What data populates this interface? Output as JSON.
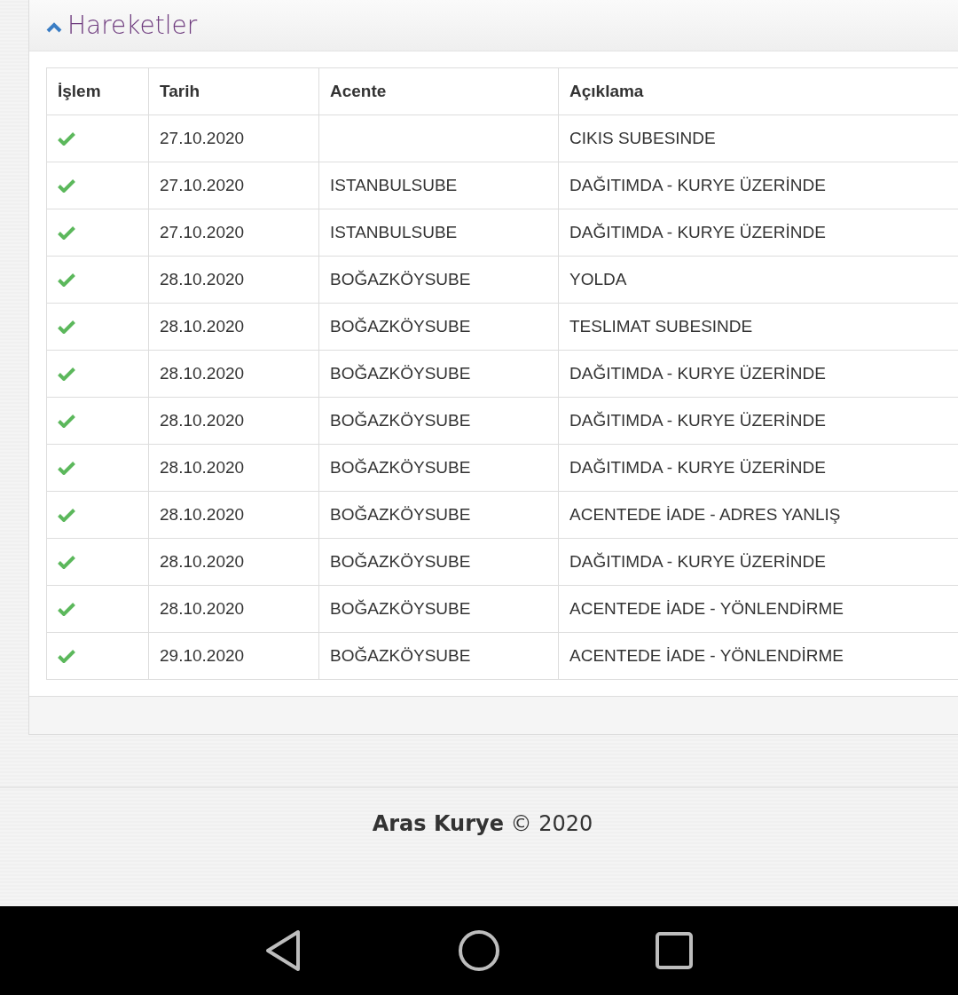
{
  "panel": {
    "title": "Hareketler"
  },
  "table": {
    "columns": [
      "İşlem",
      "Tarih",
      "Acente",
      "Açıklama"
    ],
    "rows": [
      {
        "date": "27.10.2020",
        "agent": "",
        "description": "CIKIS SUBESINDE"
      },
      {
        "date": "27.10.2020",
        "agent": "ISTANBULSUBE",
        "description": "DAĞITIMDA - KURYE ÜZERİNDE"
      },
      {
        "date": "27.10.2020",
        "agent": "ISTANBULSUBE",
        "description": "DAĞITIMDA - KURYE ÜZERİNDE"
      },
      {
        "date": "28.10.2020",
        "agent": "BOĞAZKÖYSUBE",
        "description": "YOLDA"
      },
      {
        "date": "28.10.2020",
        "agent": "BOĞAZKÖYSUBE",
        "description": "TESLIMAT SUBESINDE"
      },
      {
        "date": "28.10.2020",
        "agent": "BOĞAZKÖYSUBE",
        "description": "DAĞITIMDA - KURYE ÜZERİNDE"
      },
      {
        "date": "28.10.2020",
        "agent": "BOĞAZKÖYSUBE",
        "description": "DAĞITIMDA - KURYE ÜZERİNDE"
      },
      {
        "date": "28.10.2020",
        "agent": "BOĞAZKÖYSUBE",
        "description": "DAĞITIMDA - KURYE ÜZERİNDE"
      },
      {
        "date": "28.10.2020",
        "agent": "BOĞAZKÖYSUBE",
        "description": "ACENTEDE İADE - ADRES YANLIŞ"
      },
      {
        "date": "28.10.2020",
        "agent": "BOĞAZKÖYSUBE",
        "description": "DAĞITIMDA - KURYE ÜZERİNDE"
      },
      {
        "date": "28.10.2020",
        "agent": "BOĞAZKÖYSUBE",
        "description": "ACENTEDE İADE - YÖNLENDİRME"
      },
      {
        "date": "29.10.2020",
        "agent": "BOĞAZKÖYSUBE",
        "description": "ACENTEDE İADE - YÖNLENDİRME"
      }
    ]
  },
  "footer": {
    "text": "**Aras Kurye** © 2020"
  }
}
